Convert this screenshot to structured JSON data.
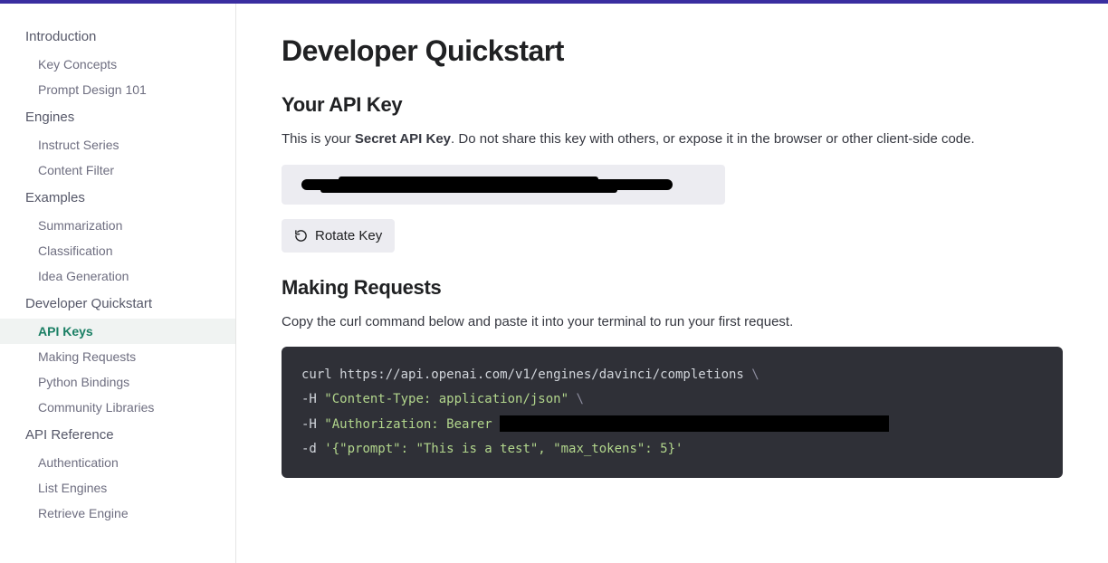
{
  "sidebar": {
    "sections": [
      {
        "label": "Introduction",
        "items": [
          {
            "label": "Key Concepts"
          },
          {
            "label": "Prompt Design 101"
          }
        ]
      },
      {
        "label": "Engines",
        "items": [
          {
            "label": "Instruct Series"
          },
          {
            "label": "Content Filter"
          }
        ]
      },
      {
        "label": "Examples",
        "items": [
          {
            "label": "Summarization"
          },
          {
            "label": "Classification"
          },
          {
            "label": "Idea Generation"
          }
        ]
      },
      {
        "label": "Developer Quickstart",
        "items": [
          {
            "label": "API Keys",
            "active": true
          },
          {
            "label": "Making Requests"
          },
          {
            "label": "Python Bindings"
          },
          {
            "label": "Community Libraries"
          }
        ]
      },
      {
        "label": "API Reference",
        "items": [
          {
            "label": "Authentication"
          },
          {
            "label": "List Engines"
          },
          {
            "label": "Retrieve Engine"
          }
        ]
      }
    ]
  },
  "main": {
    "title": "Developer Quickstart",
    "section1": {
      "heading": "Your API Key",
      "intro_pre": "This is your ",
      "intro_bold": "Secret API Key",
      "intro_post": ". Do not share this key with others, or expose it in the browser or other client-side code.",
      "rotate_label": "Rotate Key"
    },
    "section2": {
      "heading": "Making Requests",
      "intro": "Copy the curl command below and paste it into your terminal to run your first request.",
      "code": {
        "line1_pre": "curl https://api.openai.com/v1/engines/davinci/completions ",
        "slash": "\\",
        "line2_flag": "-H ",
        "line2_str": "\"Content-Type: application/json\"",
        "line3_flag": "-H ",
        "line3_str_pre": "\"Authorization: Bearer ",
        "line4_flag": "-d ",
        "line4_str": "'{\"prompt\": \"This is a test\", \"max_tokens\": 5}'"
      }
    }
  }
}
